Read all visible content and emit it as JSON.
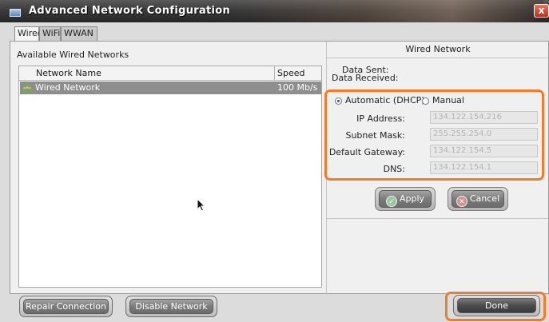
{
  "window": {
    "title": "Advanced Network Configuration",
    "close_label": "x"
  },
  "tabs": [
    {
      "label": "Wired",
      "active": true
    },
    {
      "label": "WiFi",
      "active": false
    },
    {
      "label": "WWAN",
      "active": false
    }
  ],
  "left": {
    "header": "Available Wired Networks",
    "columns": {
      "name": "Network Name",
      "speed": "Speed"
    },
    "networks": [
      {
        "name": "Wired Network",
        "speed": "100 Mb/s",
        "icon": "network-icon",
        "selected": true
      }
    ]
  },
  "right": {
    "title": "Wired Network",
    "data_sent_label": "Data Sent:",
    "data_received_label": "Data Received:",
    "mode": {
      "automatic_label": "Automatic (DHCP)",
      "manual_label": "Manual",
      "selected": "automatic"
    },
    "fields": [
      {
        "label": "IP Address:",
        "value": "134.122.154.216"
      },
      {
        "label": "Subnet Mask:",
        "value": "255.255.254.0"
      },
      {
        "label": "Default Gateway:",
        "value": "134.122.154.5"
      },
      {
        "label": "DNS:",
        "value": "134.122.154.1"
      }
    ],
    "apply_label": "Apply",
    "cancel_label": "Cancel"
  },
  "bottom": {
    "repair_label": "Repair Connection",
    "disable_label": "Disable Network",
    "done_label": "Done"
  },
  "colors": {
    "highlight": "#ef7d2c",
    "selected_row": "#8e8e8e",
    "radio_dot": "#2f55c9"
  }
}
